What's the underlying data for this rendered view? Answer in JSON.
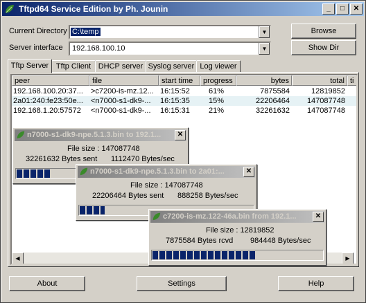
{
  "window": {
    "title": "Tftpd64 Service Edition by Ph. Jounin",
    "minimize": "_",
    "maximize": "□",
    "close": "✕"
  },
  "settings": {
    "current_directory_label": "Current Directory",
    "current_directory_value": "C:\\temp",
    "server_interface_label": "Server interface",
    "server_interface_value": "192.168.100.10",
    "browse_label": "Browse",
    "showdir_label": "Show Dir"
  },
  "tabs": [
    "Tftp Server",
    "Tftp Client",
    "DHCP server",
    "Syslog server",
    "Log viewer"
  ],
  "table": {
    "columns": [
      "peer",
      "file",
      "start time",
      "progress",
      "bytes",
      "total",
      "ti"
    ],
    "rows": [
      {
        "peer": "192.168.100.20:37...",
        "file": ">c7200-is-mz.12...",
        "start": "16:15:52",
        "progress": "61%",
        "bytes": "7875584",
        "total": "12819852"
      },
      {
        "peer": "2a01:240:fe23:50e...",
        "file": "<n7000-s1-dk9-...",
        "start": "16:15:35",
        "progress": "15%",
        "bytes": "22206464",
        "total": "147087748"
      },
      {
        "peer": "192.168.1.20:57572",
        "file": "<n7000-s1-dk9-...",
        "start": "16:15:31",
        "progress": "21%",
        "bytes": "32261632",
        "total": "147087748"
      }
    ]
  },
  "popups": [
    {
      "title": "n7000-s1-dk9-npe.5.1.3.bin to 192.1...",
      "file_size": "File size : 147087748",
      "bytes_text": "32261632 Bytes sent",
      "rate": "1112470 Bytes/sec",
      "progress": 0.21
    },
    {
      "title": "n7000-s1-dk9-npe.5.1.3.bin to 2a01:...",
      "file_size": "File size : 147087748",
      "bytes_text": "22206464 Bytes sent",
      "rate": "888258 Bytes/sec",
      "progress": 0.15
    },
    {
      "title": "c7200-is-mz.122-46a.bin from 192.1...",
      "file_size": "File size : 12819852",
      "bytes_text": "7875584 Bytes rcvd",
      "rate": "984448 Bytes/sec",
      "progress": 0.61
    }
  ],
  "buttons": {
    "about": "About",
    "settings": "Settings",
    "help": "Help"
  },
  "icons": {
    "app": "tftp-leaf-icon",
    "popup": "tftp-leaf-icon"
  }
}
